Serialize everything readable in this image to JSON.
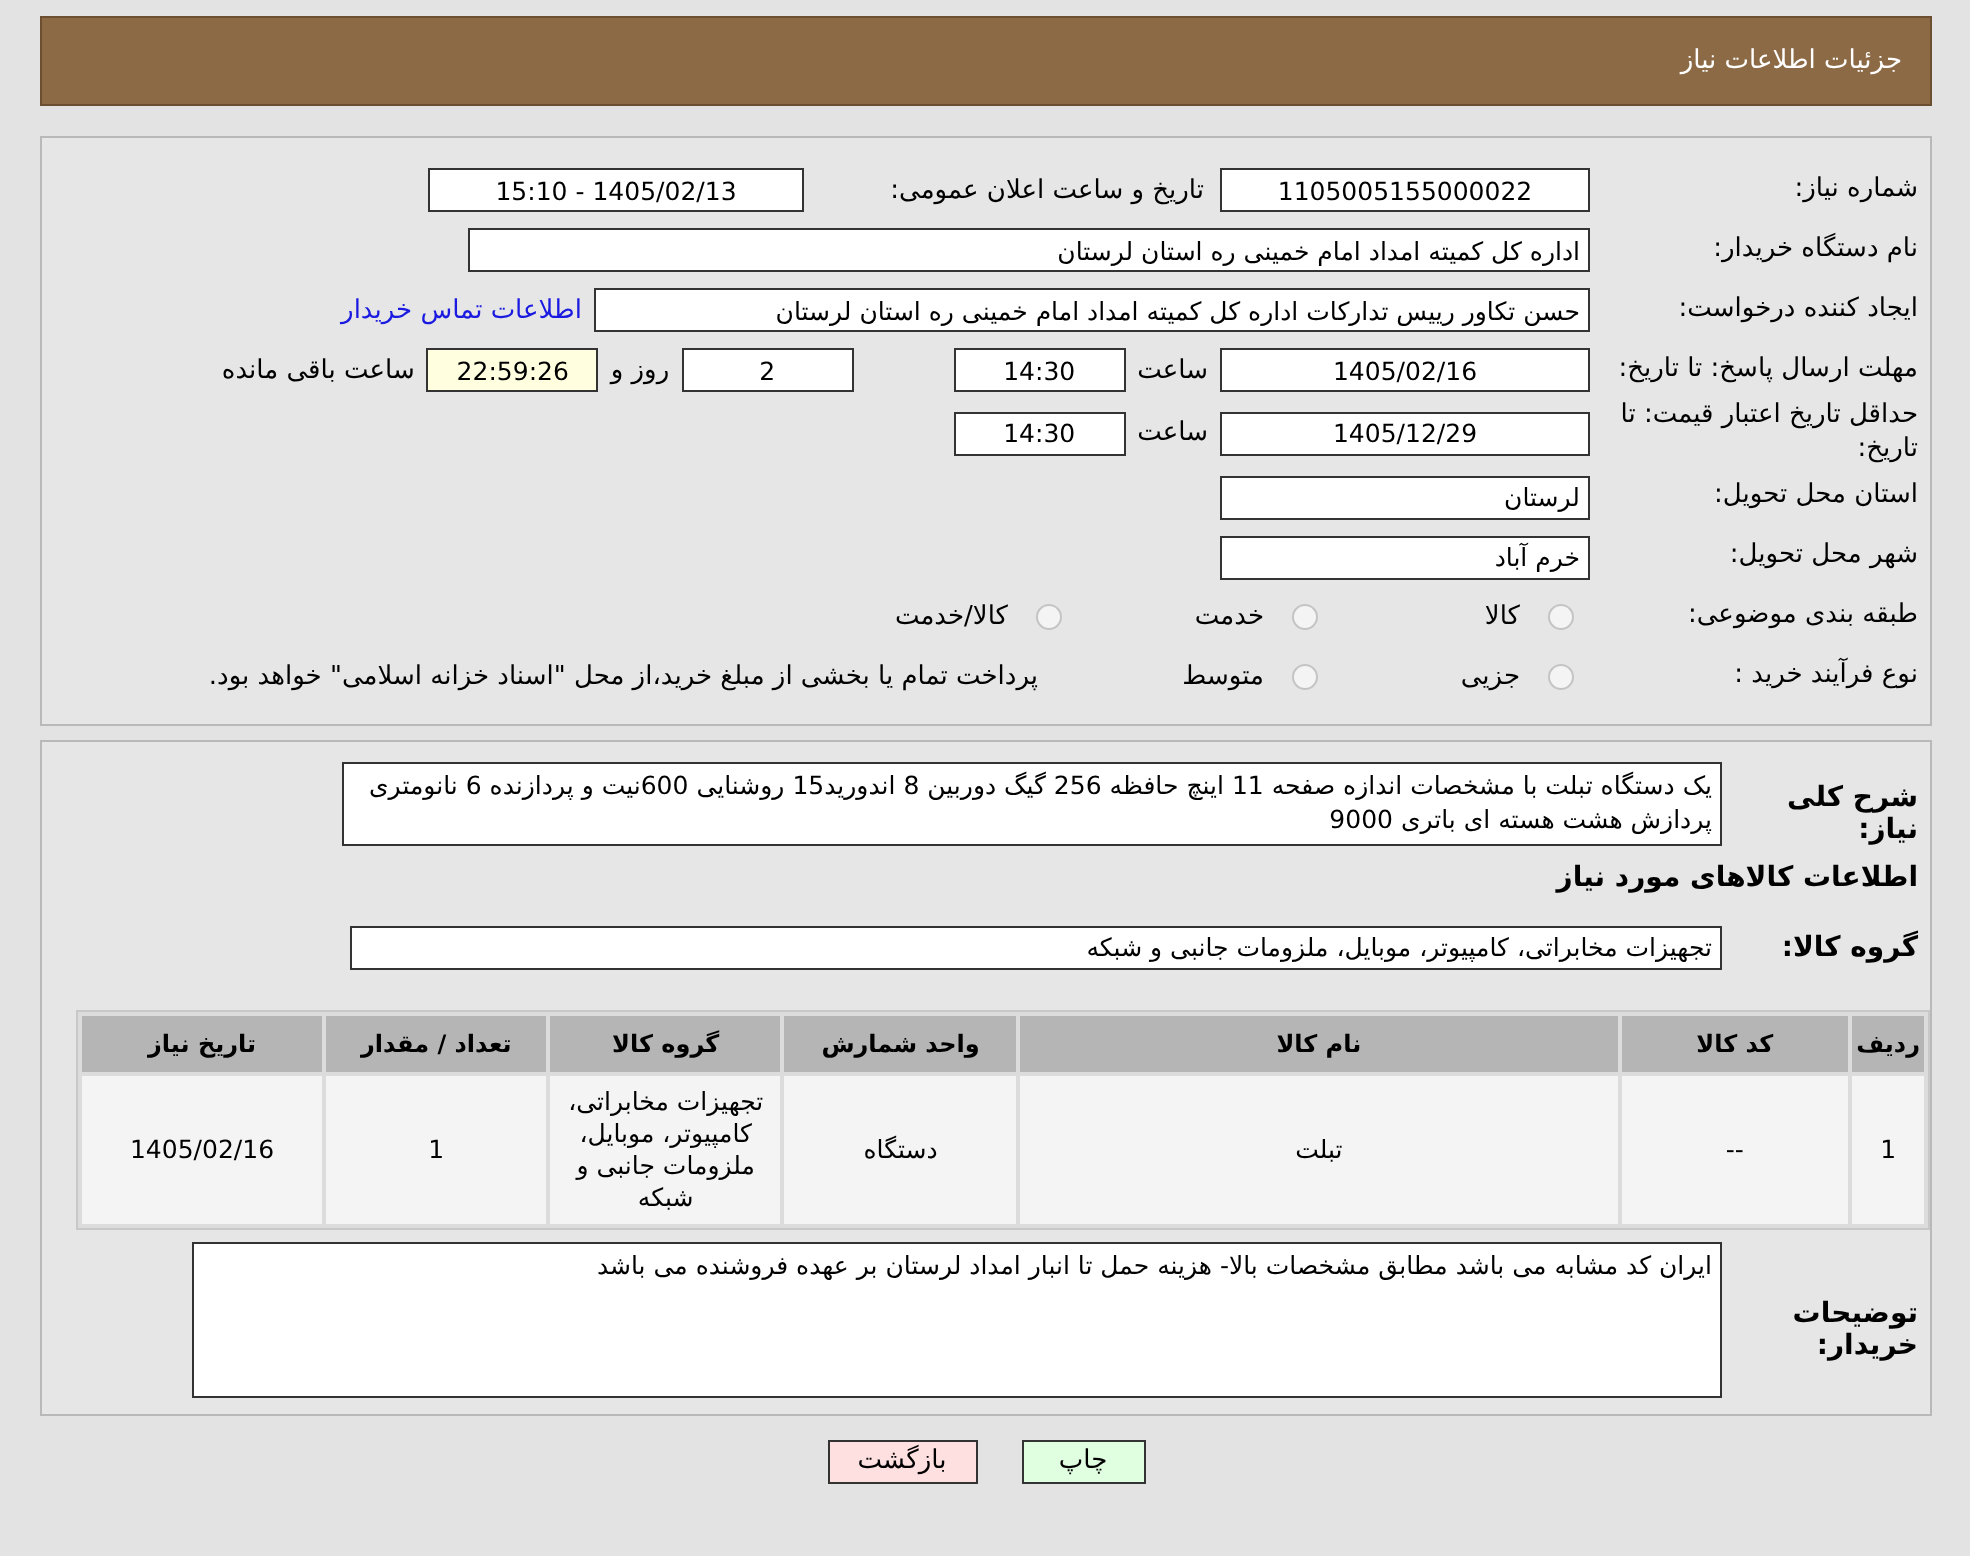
{
  "header": {
    "title": "جزئیات اطلاعات نیاز"
  },
  "info": {
    "need_number": {
      "label": "شماره نیاز:",
      "value": "1105005155000022"
    },
    "announce": {
      "label": "تاریخ و ساعت اعلان عمومی:",
      "value": "1405/02/13 - 15:10"
    },
    "buyer": {
      "label": "نام دستگاه خریدار:",
      "value": "اداره کل کمیته امداد امام خمینی  ره  استان لرستان"
    },
    "creator": {
      "label": "ایجاد کننده درخواست:",
      "value": "حسن تکاور رییس تدارکات اداره کل کمیته امداد امام خمینی  ره  استان لرستان",
      "link": "اطلاعات تماس خریدار"
    },
    "deadline": {
      "label": "مهلت ارسال پاسخ: تا تاریخ:",
      "date": "1405/02/16",
      "time_label": "ساعت",
      "time": "14:30",
      "days": "2",
      "days_label": "روز و",
      "remaining": "22:59:26",
      "remaining_label": "ساعت باقی مانده"
    },
    "validity": {
      "label": "حداقل تاریخ اعتبار قیمت: تا تاریخ:",
      "date": "1405/12/29",
      "time_label": "ساعت",
      "time": "14:30"
    },
    "province": {
      "label": "استان محل تحویل:",
      "value": "لرستان"
    },
    "city": {
      "label": "شهر محل تحویل:",
      "value": "خرم آباد"
    },
    "category": {
      "label": "طبقه بندی موضوعی:",
      "options": [
        {
          "label": "کالا",
          "selected": false
        },
        {
          "label": "خدمت",
          "selected": false
        },
        {
          "label": "کالا/خدمت",
          "selected": false
        }
      ]
    },
    "purchase": {
      "label": "نوع فرآیند خرید :",
      "options": [
        {
          "label": "جزیی",
          "selected": false
        },
        {
          "label": "متوسط",
          "selected": false
        }
      ],
      "note": "پرداخت تمام یا بخشی از مبلغ خرید،از محل \"اسناد خزانه اسلامی\" خواهد بود."
    }
  },
  "details": {
    "summary_label": "شرح کلی نیاز:",
    "summary": "یک دستگاه تبلت با مشخصات اندازه صفحه 11 اینچ حافظه 256 گیگ دوربین 8 اندورید15 روشنایی 600نیت و پردازنده 6 نانومتری پردازش هشت هسته ای باتری 9000",
    "goods_title": "اطلاعات کالاهای مورد نیاز",
    "group_label": "گروه کالا:",
    "group": "تجهیزات مخابراتی، کامپیوتر، موبایل، ملزومات جانبی و شبکه",
    "table": {
      "columns": [
        "ردیف",
        "کد کالا",
        "نام کالا",
        "واحد شمارش",
        "گروه کالا",
        "تعداد / مقدار",
        "تاریخ نیاز"
      ],
      "rows": [
        [
          "1",
          "--",
          "تبلت",
          "دستگاه",
          "تجهیزات مخابراتی، کامپیوتر، موبایل، ملزومات جانبی و شبکه",
          "1",
          "1405/02/16"
        ]
      ]
    },
    "notes_label": "توضیحات خریدار:",
    "notes": "ایران کد مشابه می باشد مطابق مشخصات بالا- هزینه حمل تا انبار امداد لرستان بر عهده فروشنده می باشد"
  },
  "buttons": [
    {
      "label": "چاپ",
      "kind": "print"
    },
    {
      "label": "بازگشت",
      "kind": "back"
    }
  ]
}
